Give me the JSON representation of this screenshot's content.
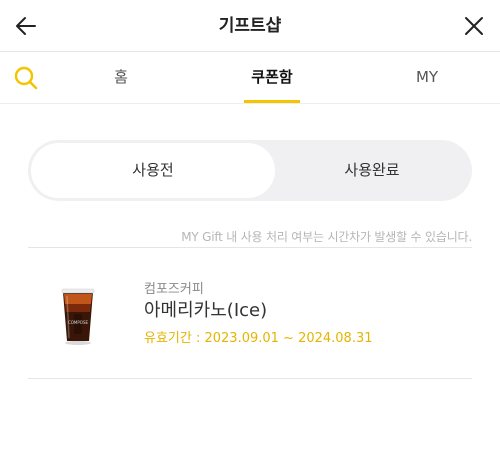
{
  "header": {
    "title": "기프트샵",
    "back_icon": "arrow-left-icon",
    "close_icon": "close-icon"
  },
  "tabs": {
    "search_icon": "search-icon",
    "items": [
      {
        "label": "홈",
        "active": false
      },
      {
        "label": "쿠폰함",
        "active": true
      },
      {
        "label": "MY",
        "active": false
      }
    ],
    "accent_color": "#f5c400"
  },
  "segment": {
    "options": [
      {
        "label": "사용전",
        "selected": true
      },
      {
        "label": "사용완료",
        "selected": false
      }
    ]
  },
  "notice": "MY Gift 내 사용 처리 여부는 시간차가 발생할 수 있습니다.",
  "coupons": [
    {
      "brand": "컴포즈커피",
      "name": "아메리카노(Ice)",
      "validity": "유효기간 : 2023.09.01 ~ 2024.08.31",
      "image_icon": "iced-coffee-cup-icon"
    }
  ],
  "colors": {
    "accent": "#f5c400",
    "validity_text": "#e6b400"
  }
}
